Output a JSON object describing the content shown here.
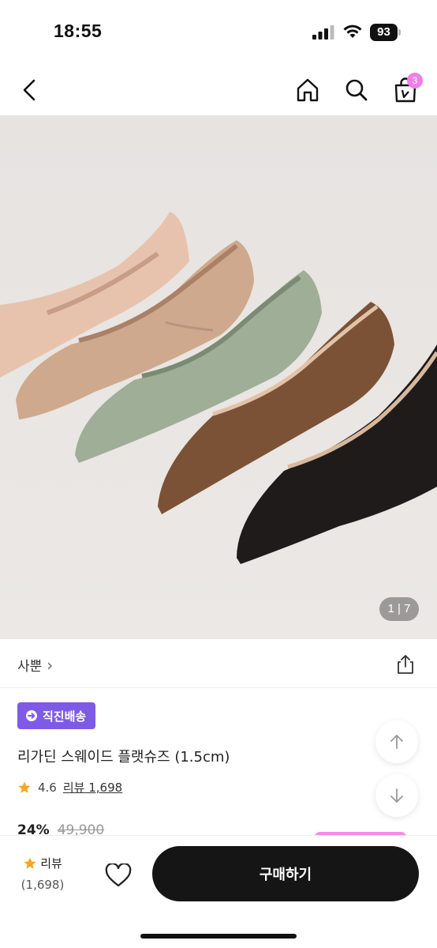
{
  "status_bar": {
    "time": "18:55",
    "battery": "93",
    "icons": [
      "signal-icon",
      "wifi-icon",
      "battery-icon"
    ]
  },
  "nav": {
    "icons": [
      "back-icon",
      "home-icon",
      "search-icon",
      "bag-icon"
    ],
    "cart_count": "3",
    "badge_color": "#ef7ee8"
  },
  "gallery": {
    "page_indicator": "1 | 7"
  },
  "brand": {
    "name": "사뿐",
    "chevron": "›",
    "share_icon": "share-icon"
  },
  "product": {
    "badge_label": "직진배송",
    "badge_color": "#7f5ae6",
    "title": "리가딘 스웨이드 플랫슈즈 (1.5cm)",
    "rating": "4.6",
    "review_link": "리뷰 1,698",
    "discount": "24%",
    "original_price": "49,900"
  },
  "bottom_bar": {
    "review_label": "리뷰",
    "review_count": "(1,698)",
    "buy_label": "구매하기",
    "buy_color": "#151515"
  }
}
